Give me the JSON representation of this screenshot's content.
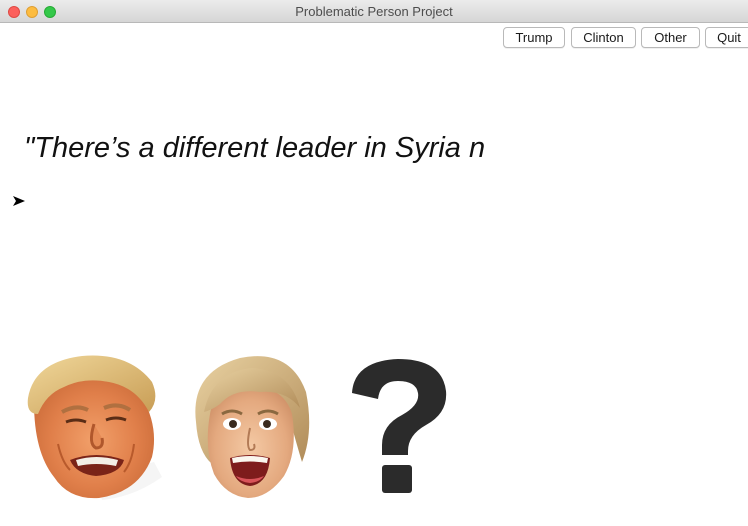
{
  "window": {
    "title": "Problematic Person Project"
  },
  "toolbar": {
    "buttons": [
      {
        "label": "Trump"
      },
      {
        "label": "Clinton"
      },
      {
        "label": "Other"
      },
      {
        "label": "Quit"
      }
    ]
  },
  "main": {
    "quote_text": "\"There’s a different leader in Syria n"
  },
  "choices": [
    {
      "name": "trump",
      "icon": "trump-face-icon"
    },
    {
      "name": "clinton",
      "icon": "clinton-face-icon"
    },
    {
      "name": "other",
      "icon": "question-mark-icon"
    }
  ],
  "colors": {
    "question_mark": "#2b2b2b"
  }
}
